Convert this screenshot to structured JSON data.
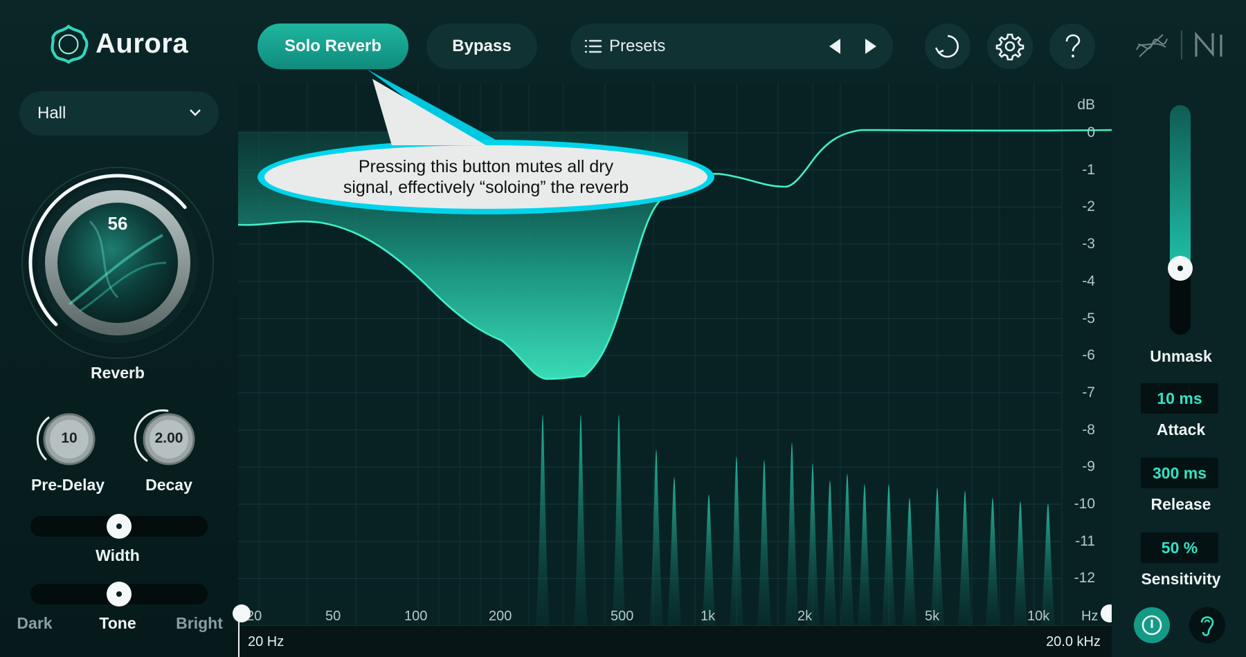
{
  "app": {
    "title": "Aurora"
  },
  "toolbar": {
    "solo_label": "Solo Reverb",
    "bypass_label": "Bypass",
    "presets_label": "Presets",
    "undo_icon": "history-icon",
    "settings_icon": "gear-icon",
    "help_icon": "question-icon"
  },
  "left_panel": {
    "mode": "Hall",
    "reverb": {
      "value": "56",
      "label": "Reverb",
      "level": 0.56
    },
    "pre_delay": {
      "value": "10",
      "label": "Pre-Delay"
    },
    "decay": {
      "value": "2.00",
      "label": "Decay"
    },
    "width": {
      "label": "Width",
      "position": 0.5
    },
    "tone": {
      "label": "Tone",
      "left": "Dark",
      "right": "Bright",
      "position": 0.5
    }
  },
  "graph": {
    "db_unit": "dB",
    "db_ticks": [
      "0",
      "-1",
      "-2",
      "-3",
      "-4",
      "-5",
      "-6",
      "-7",
      "-8",
      "-9",
      "-10",
      "-11",
      "-12"
    ],
    "freq_ticks": [
      "20",
      "50",
      "100",
      "200",
      "500",
      "1k",
      "2k",
      "5k",
      "10k",
      "Hz"
    ],
    "range_low": "20 Hz",
    "range_high": "20.0 kHz"
  },
  "callout": {
    "line1": "Pressing this button mutes all dry",
    "line2": "signal,  effectively “soloing” the reverb"
  },
  "right_panel": {
    "unmask": {
      "label": "Unmask",
      "level": 0.29
    },
    "attack": {
      "value": "10 ms",
      "label": "Attack"
    },
    "release": {
      "value": "300 ms",
      "label": "Release"
    },
    "sensitivity": {
      "value": "50 %",
      "label": "Sensitivity"
    }
  },
  "colors": {
    "accent": "#1fb6a0",
    "curve": "#3ff0c8",
    "background": "#082021",
    "value_text": "#33e3c4"
  }
}
